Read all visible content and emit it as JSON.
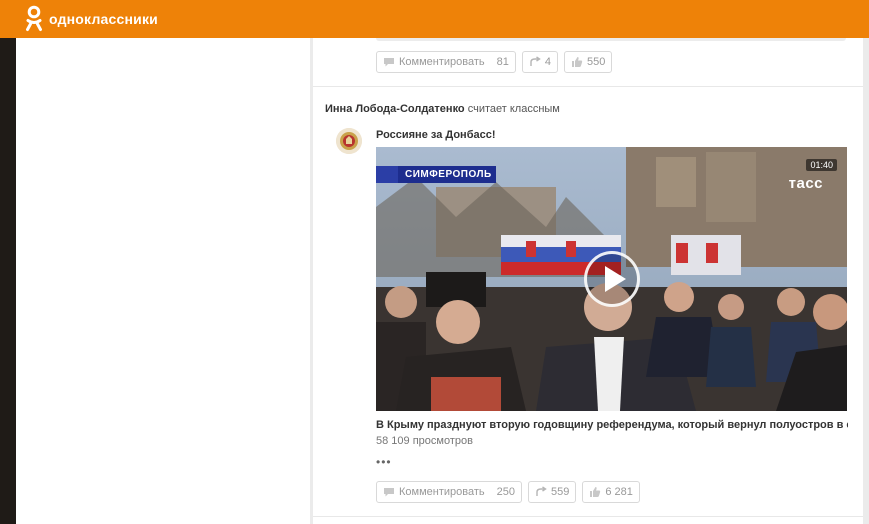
{
  "header": {
    "logo_text": "одноклассники",
    "brand_color": "#ee8208"
  },
  "previous_post": {
    "actions": {
      "comment_label": "Комментировать",
      "comment_count": "81",
      "share_count": "4",
      "like_count": "550"
    }
  },
  "post": {
    "liker_name": "Инна Лобода-Солдатенко",
    "liker_action": "считает классным",
    "group_name": "Россияне за Донбасс!",
    "video": {
      "duration": "01:40",
      "city_caption": "СИМФЕРОПОЛЬ",
      "channel_logo": "тасс",
      "title": "В Крыму празднуют вторую годовщину референдума, который вернул полуостров в со...",
      "views": "58 109 просмотров"
    },
    "more": "•••",
    "actions": {
      "comment_label": "Комментировать",
      "comment_count": "250",
      "share_count": "559",
      "like_count": "6 281"
    }
  },
  "icons": {
    "comment": "comment-icon",
    "share": "share-icon",
    "like": "like-icon",
    "play": "play-icon"
  }
}
